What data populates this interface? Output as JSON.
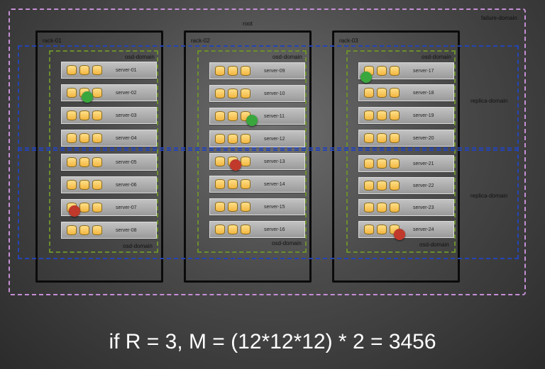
{
  "domains": {
    "root_label": "root",
    "failure_label": "failure-domain",
    "replica_label": "replica-domain",
    "osd_label": "osd-domain"
  },
  "racks": [
    {
      "label": "rack-01",
      "servers": [
        "server-01",
        "server-02",
        "server-03",
        "server-04",
        "server-05",
        "server-06",
        "server-07",
        "server-08"
      ]
    },
    {
      "label": "rack-02",
      "servers": [
        "server-09",
        "server-10",
        "server-11",
        "server-12",
        "server-13",
        "server-14",
        "server-15",
        "server-16"
      ]
    },
    {
      "label": "rack-03",
      "servers": [
        "server-17",
        "server-18",
        "server-19",
        "server-20",
        "server-21",
        "server-22",
        "server-23",
        "server-24"
      ]
    }
  ],
  "markers": [
    {
      "server": "server-02",
      "color": "#3aa63e"
    },
    {
      "server": "server-11",
      "color": "#3aa63e"
    },
    {
      "server": "server-17",
      "color": "#3aa63e"
    },
    {
      "server": "server-07",
      "color": "#c0392b"
    },
    {
      "server": "server-13",
      "color": "#c0392b"
    },
    {
      "server": "server-24",
      "color": "#c0392b"
    }
  ],
  "formula": "if R = 3,  M = (12*12*12) * 2 = 3456"
}
